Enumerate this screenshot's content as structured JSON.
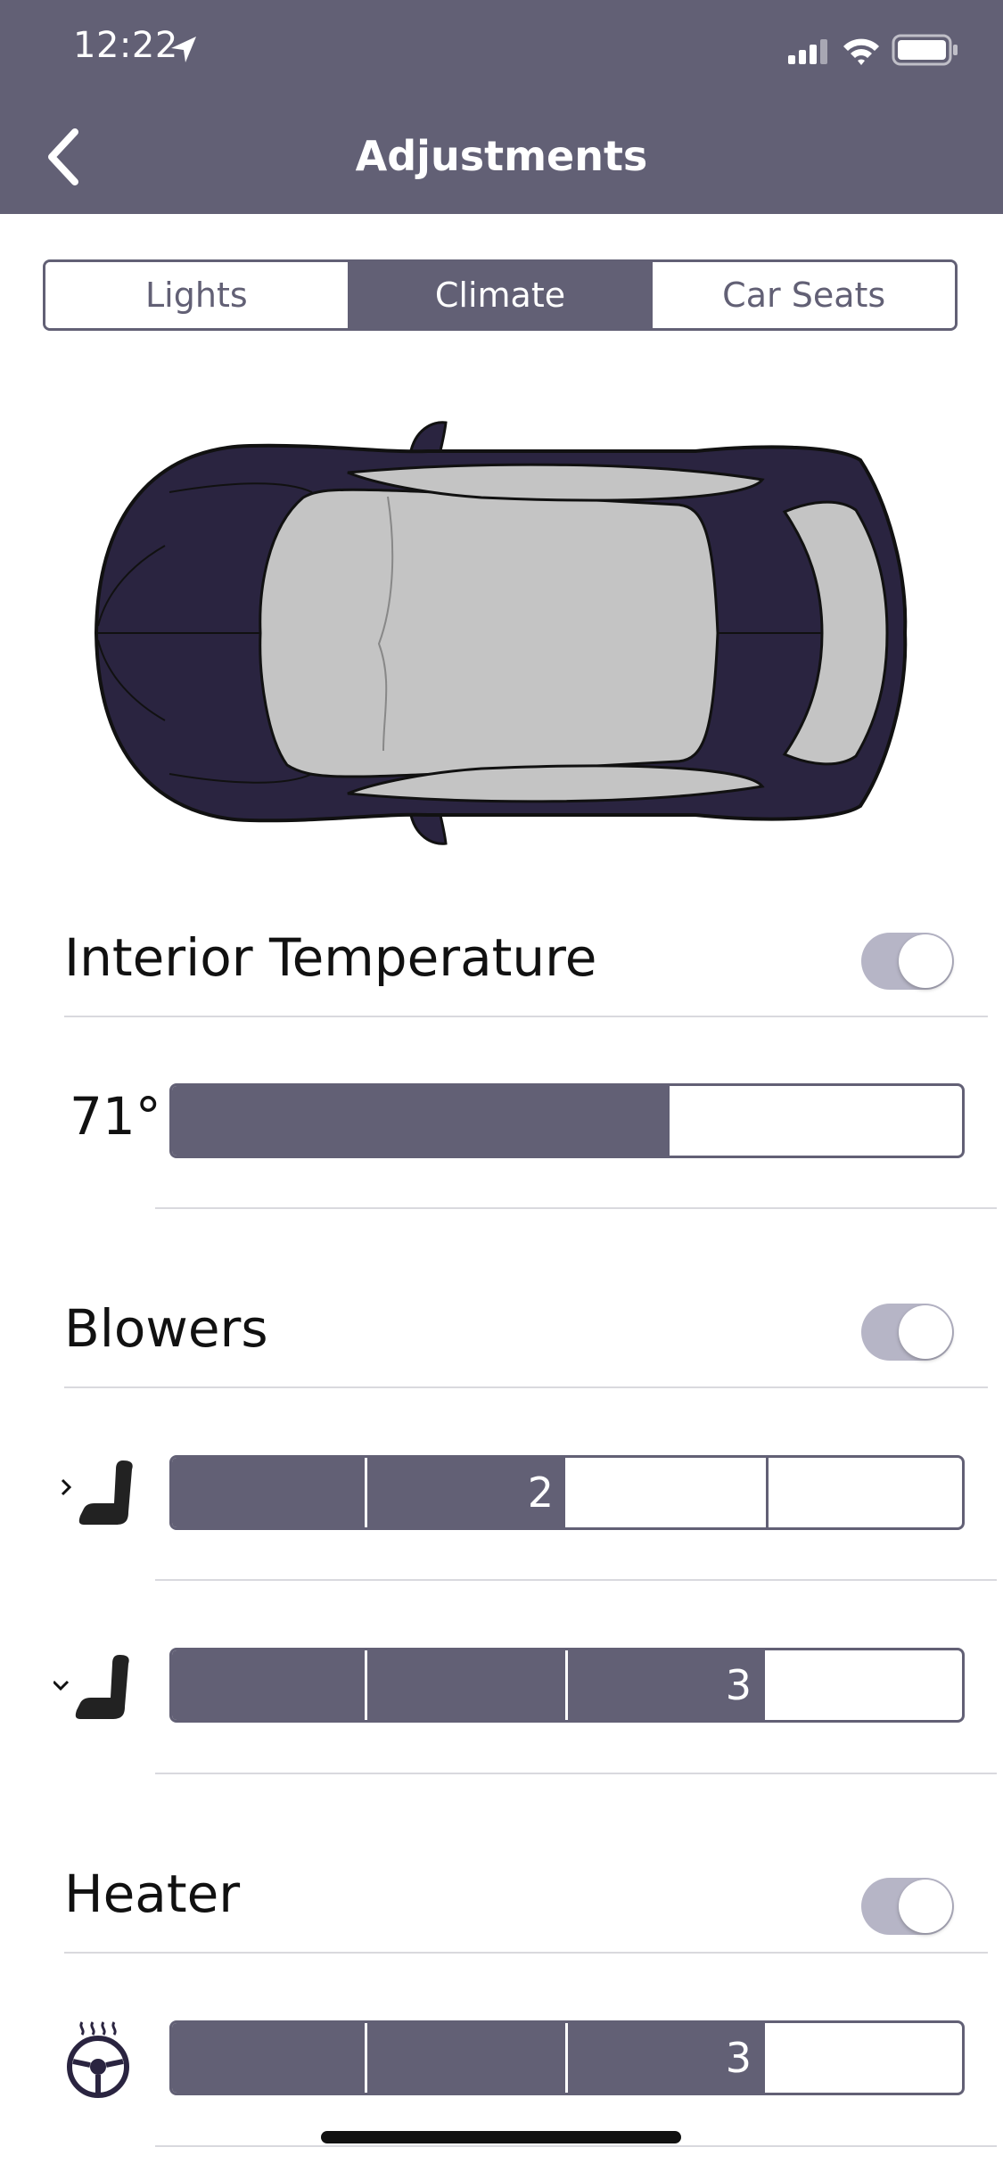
{
  "status_bar": {
    "time": "12:22",
    "location_icon": "location-arrow-icon",
    "signal_icon": "signal-icon",
    "wifi_icon": "wifi-icon",
    "battery_icon": "battery-icon"
  },
  "nav": {
    "back_icon": "chevron-left-icon",
    "title": "Adjustments"
  },
  "tabs": [
    {
      "label": "Lights",
      "active": false
    },
    {
      "label": "Climate",
      "active": true
    },
    {
      "label": "Car Seats",
      "active": false
    }
  ],
  "colors": {
    "accent": "#626075",
    "car_body": "#2a2440",
    "car_glass": "#c4c4c4",
    "toggle_track": "#b6b5c6"
  },
  "interior_temperature": {
    "title": "Interior Temperature",
    "enabled": true,
    "value_label": "71°",
    "level_fraction": 0.63
  },
  "blowers": {
    "title": "Blowers",
    "enabled": true,
    "rows": [
      {
        "icon": "seat-front-icon",
        "value": "2",
        "level": 2,
        "max": 4
      },
      {
        "icon": "seat-rear-icon",
        "value": "3",
        "level": 3,
        "max": 4
      }
    ]
  },
  "heater": {
    "title": "Heater",
    "enabled": true,
    "rows": [
      {
        "icon": "heated-steering-wheel-icon",
        "value": "3",
        "level": 3,
        "max": 4
      }
    ]
  }
}
